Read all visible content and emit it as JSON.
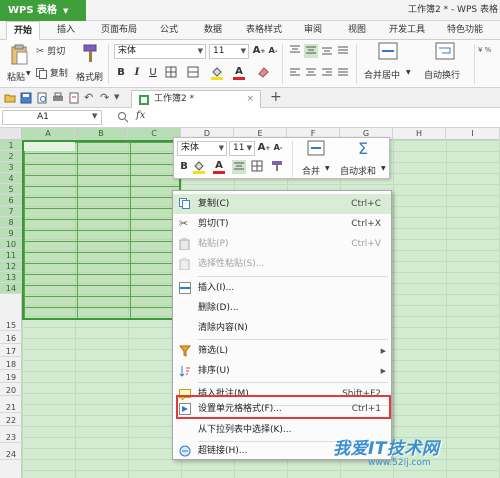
{
  "titlebar": {
    "app_button": "WPS 表格",
    "document_title": "工作簿2 * - WPS 表格"
  },
  "ribbon_tabs": [
    {
      "label": "开始",
      "active": true
    },
    {
      "label": "插入"
    },
    {
      "label": "页面布局"
    },
    {
      "label": "公式"
    },
    {
      "label": "数据"
    },
    {
      "label": "表格样式"
    },
    {
      "label": "审阅"
    },
    {
      "label": "视图"
    },
    {
      "label": "开发工具"
    },
    {
      "label": "特色功能"
    }
  ],
  "ribbon": {
    "paste": "粘贴",
    "cut": "剪切",
    "copy": "复制",
    "format_painter": "格式刷",
    "font_name": "宋体",
    "font_size": "11",
    "merge_center": "合并居中",
    "wrap_text": "自动换行"
  },
  "doc_tab": {
    "label": "工作簿2 *"
  },
  "formula_bar": {
    "name_box": "A1",
    "fx": "fx"
  },
  "columns": [
    "A",
    "B",
    "C",
    "D",
    "E",
    "F",
    "G",
    "H",
    "I"
  ],
  "rows": [
    "1",
    "2",
    "3",
    "4",
    "5",
    "6",
    "7",
    "8",
    "9",
    "10",
    "11",
    "12",
    "13",
    "14",
    "15",
    "16",
    "17",
    "18",
    "19",
    "20",
    "21",
    "22",
    "23",
    "24"
  ],
  "mini_toolbar": {
    "font_name": "宋体",
    "font_size": "11",
    "merge": "合并",
    "autosum": "自动求和"
  },
  "context_menu": [
    {
      "label": "复制(C)",
      "shortcut": "Ctrl+C",
      "icon": "copy-icon"
    },
    {
      "label": "剪切(T)",
      "shortcut": "Ctrl+X",
      "icon": "scissors-icon"
    },
    {
      "label": "粘贴(P)",
      "shortcut": "Ctrl+V",
      "icon": "paste-icon",
      "disabled": true
    },
    {
      "label": "选择性粘贴(S)...",
      "icon": "paste-special-icon",
      "disabled": true
    },
    {
      "label": "插入(I)...",
      "icon": "insert-icon"
    },
    {
      "label": "删除(D)..."
    },
    {
      "label": "清除内容(N)"
    },
    {
      "label": "筛选(L)",
      "icon": "filter-icon",
      "submenu": true
    },
    {
      "label": "排序(U)",
      "icon": "sort-icon",
      "submenu": true
    },
    {
      "label": "插入批注(M)...",
      "shortcut": "Shift+F2",
      "icon": "comment-icon"
    },
    {
      "label": "设置单元格格式(F)...",
      "shortcut": "Ctrl+1",
      "icon": "format-cells-icon",
      "highlighted": true
    },
    {
      "label": "从下拉列表中选择(K)..."
    },
    {
      "label": "超链接(H)...",
      "icon": "hyperlink-icon"
    }
  ],
  "watermark": {
    "text": "我爱IT技术网",
    "url": "www.52ij.com"
  },
  "colors": {
    "brand_green": "#3f9f3b",
    "selection_border": "#3c9a36",
    "highlight_box": "#e23a3a",
    "sheet_bg": "#d3ebd0"
  }
}
